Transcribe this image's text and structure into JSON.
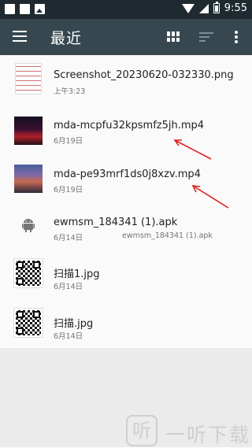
{
  "status_bar": {
    "time": "9:55"
  },
  "toolbar": {
    "title": "最近"
  },
  "files": [
    {
      "name": "Screenshot_20230620-032330.png",
      "date": "上午3:23",
      "extra": "",
      "thumb": "screenshot-thumbnail"
    },
    {
      "name": "mda-mcpfu32kpsmfz5jh.mp4",
      "date": "6月19日",
      "extra": "",
      "thumb": "video-thumbnail"
    },
    {
      "name": "mda-pe93mrf1ds0j8xzv.mp4",
      "date": "6月19日",
      "extra": "",
      "thumb": "video-thumbnail"
    },
    {
      "name": "ewmsm_184341 (1).apk",
      "date": "6月14日",
      "extra": "ewmsm_184341 (1).apk",
      "thumb": "android-icon"
    },
    {
      "name": "扫描1.jpg",
      "date": "6月14日",
      "extra": "",
      "thumb": "qr-thumbnail"
    },
    {
      "name": "扫描.jpg",
      "date": "6月14日",
      "extra": "",
      "thumb": "qr-thumbnail"
    }
  ],
  "watermark": {
    "icon_text": "听",
    "text": "一听下载"
  },
  "colors": {
    "status_bar": "#1f2a30",
    "toolbar": "#37474f",
    "annotation_arrow": "#e02020"
  }
}
